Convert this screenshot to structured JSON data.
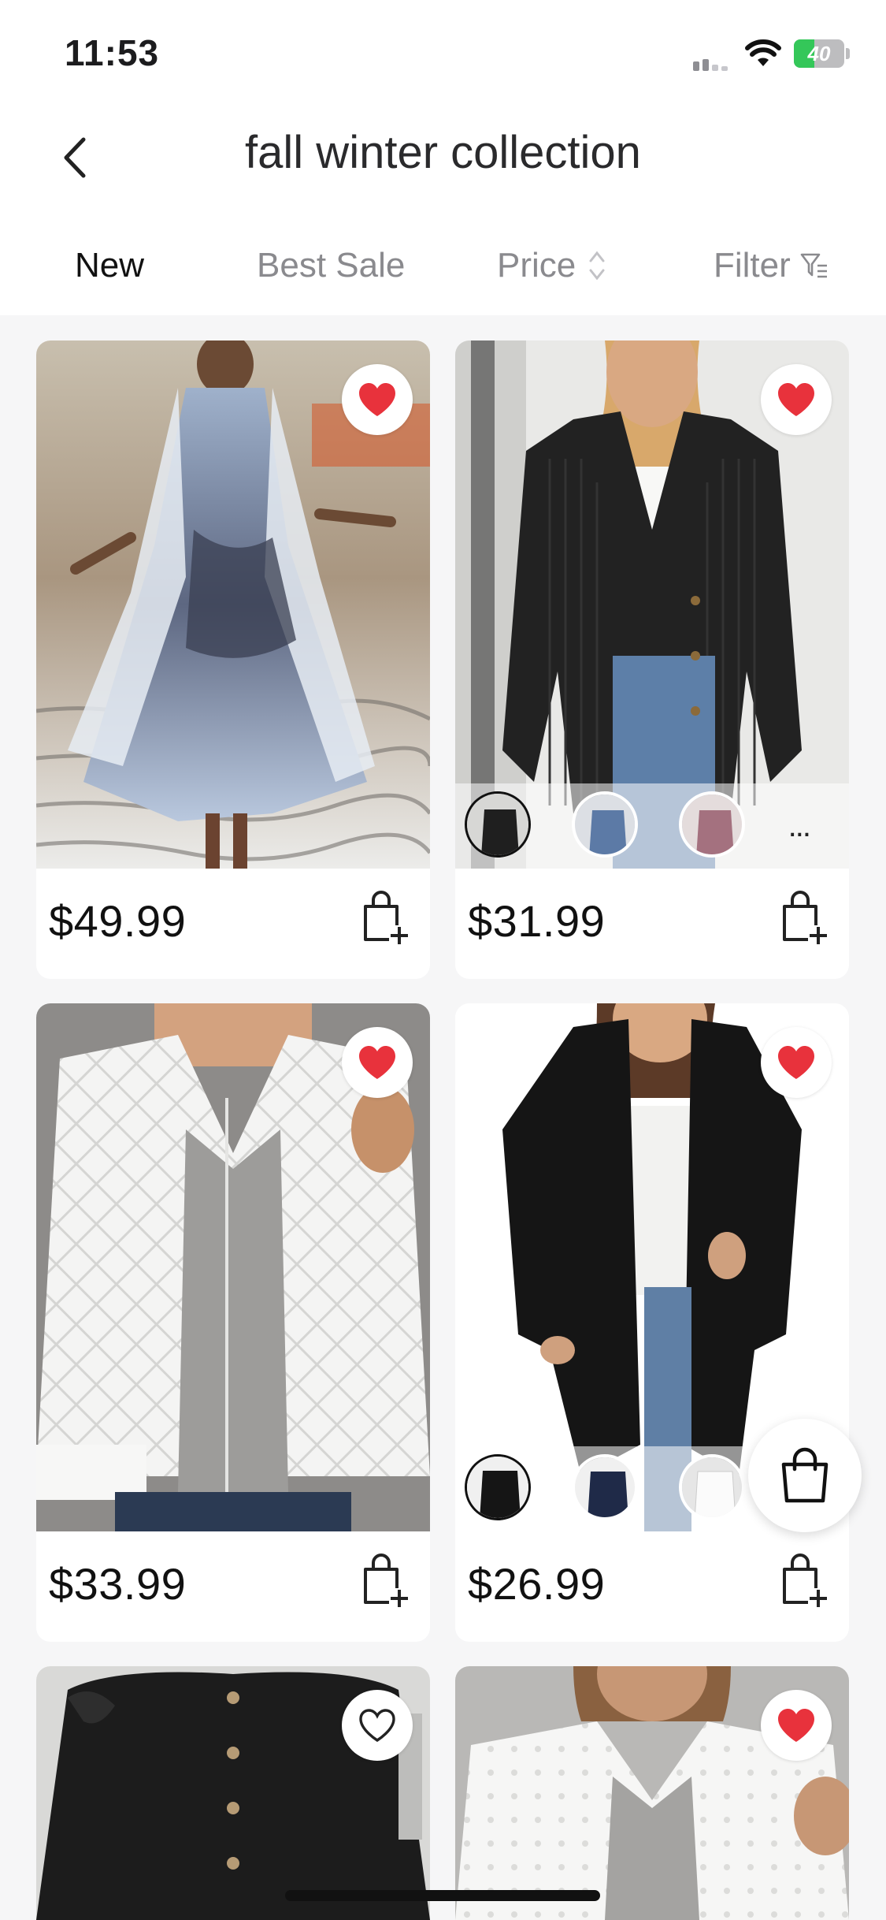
{
  "status_bar": {
    "time": "11:53",
    "battery": "40",
    "battery_level": 0.4
  },
  "header": {
    "title": "fall winter collection",
    "back_icon": "chevron-left-icon"
  },
  "tabs": [
    {
      "label": "New",
      "active": true
    },
    {
      "label": "Best Sale",
      "active": false
    },
    {
      "label": "Price",
      "active": false,
      "icon": "sort-updown-icon"
    },
    {
      "label": "Filter",
      "active": false,
      "icon": "filter-icon"
    }
  ],
  "products": [
    {
      "price": "$49.99",
      "favorited": true,
      "image": "marble-print-dress-with-cardigan"
    },
    {
      "price": "$31.99",
      "favorited": true,
      "image": "black-ribbed-button-cardigan",
      "swatches": [
        "black",
        "blue",
        "rose"
      ],
      "more": "..."
    },
    {
      "price": "$33.99",
      "favorited": true,
      "image": "white-quilted-jacket"
    },
    {
      "price": "$26.99",
      "favorited": true,
      "image": "black-open-front-cardigan",
      "swatches": [
        "black",
        "navy",
        "white"
      ]
    },
    {
      "favorited": false,
      "image": "black-ruffle-button-top"
    },
    {
      "favorited": true,
      "image": "white-eyelet-jacket"
    }
  ],
  "colors": {
    "heart": "#e8323c",
    "accent_text": "#111111",
    "muted_text": "#8a8a8e"
  },
  "fab": {
    "icon": "shopping-bag-icon"
  }
}
